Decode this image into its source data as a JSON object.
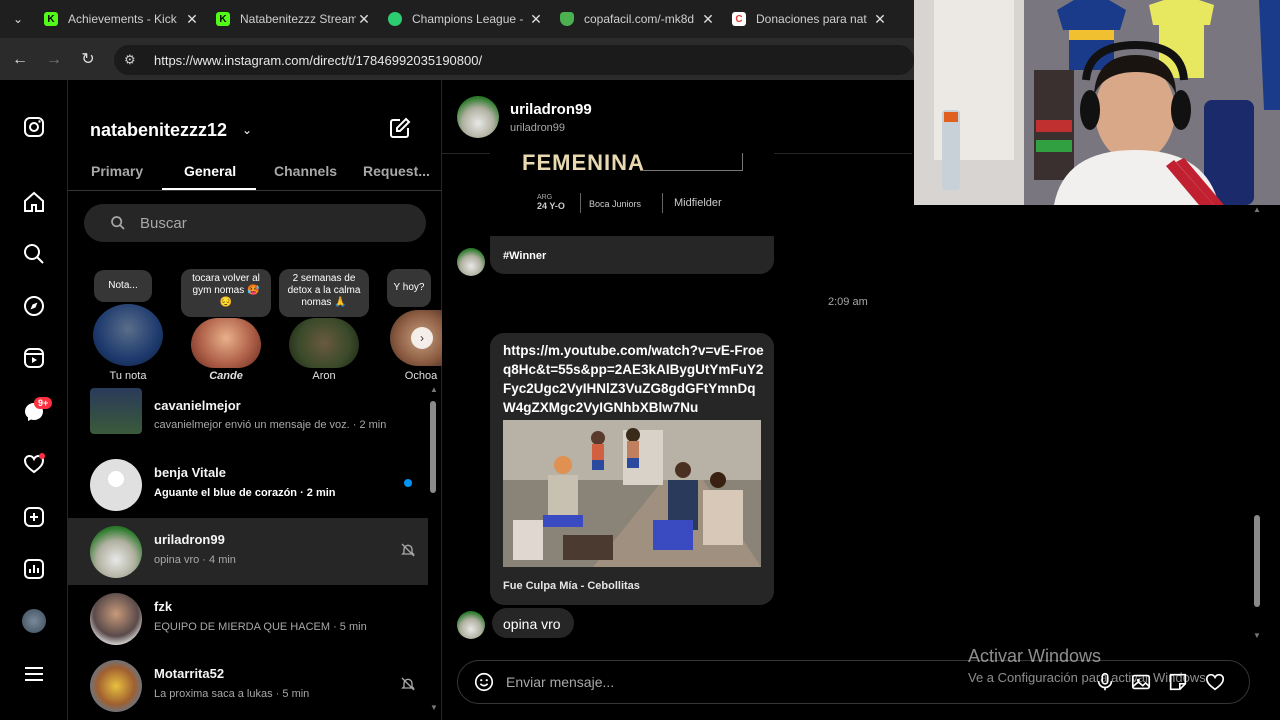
{
  "browser": {
    "tabs": [
      {
        "title": "Achievements - Kick",
        "icon": "kick-icon",
        "color": "#53fc18"
      },
      {
        "title": "Natabenitezzz Stream",
        "icon": "kick-icon",
        "color": "#53fc18"
      },
      {
        "title": "Champions League -",
        "icon": "globe-icon",
        "color": "#2ecc71"
      },
      {
        "title": "copafacil.com/-mk8d",
        "icon": "copa-icon",
        "color": "#4caf50"
      },
      {
        "title": "Donaciones para nat",
        "icon": "c-icon",
        "color": "#e53935"
      }
    ],
    "url": "https://www.instagram.com/direct/t/17846992035190800/"
  },
  "inbox": {
    "username": "natabenitezzz12",
    "tabs": [
      "Primary",
      "General",
      "Channels",
      "Request..."
    ],
    "active_tab": "General",
    "search_placeholder": "Buscar",
    "notes": [
      {
        "note": "Nota...",
        "label": "Tu nota"
      },
      {
        "note": "tocara volver al gym nomas 🥵😔",
        "label": "Cande"
      },
      {
        "note": "2 semanas de detox a la calma nomas 🙏",
        "label": "Aron"
      },
      {
        "note": "Y hoy?",
        "label": "Ochoa"
      }
    ],
    "threads": [
      {
        "name": "cavanielmejor",
        "preview": "cavanielmejor envió un mensaje de voz. · 2 min",
        "unread": false
      },
      {
        "name": "benja Vitale",
        "preview": "Aguante el blue de corazón · 2 min",
        "unread": true
      },
      {
        "name": "uriladron99",
        "preview": "opina vro · 4 min",
        "unread": false,
        "muted": true
      },
      {
        "name": "fzk",
        "preview": "EQUIPO DE MIERDA QUE HACEM · 5 min",
        "unread": false
      },
      {
        "name": "Motarrita52",
        "preview": "La proxima saca a lukas · 5 min",
        "unread": false,
        "muted": true
      }
    ],
    "badge_count": "9+"
  },
  "chat": {
    "name": "uriladron99",
    "handle": "uriladron99",
    "card_title": "FEMENINA",
    "card_meta": [
      "24 Y-O",
      "Boca Juniors",
      "Midfielder"
    ],
    "card_country": "ARG",
    "msg1": "#Winner",
    "timestamp": "2:09 am",
    "link": "https://m.youtube.com/watch?v=vE-Froeq8Hc&t=55s&pp=2AE3kAIBygUtYmFuY2Fyc2Ugc2VyIHNlZ3VuZG8gdGFtYmnDqW4gZXMgc2VyIGNhbXBlw7Nu",
    "link_caption": "Fue Culpa Mía - Cebollitas",
    "msg_last": "opina vro",
    "input_placeholder": "Enviar mensaje..."
  },
  "watermark": {
    "line1": "Activar Windows",
    "line2": "Ve a Configuración para activar Windows."
  }
}
